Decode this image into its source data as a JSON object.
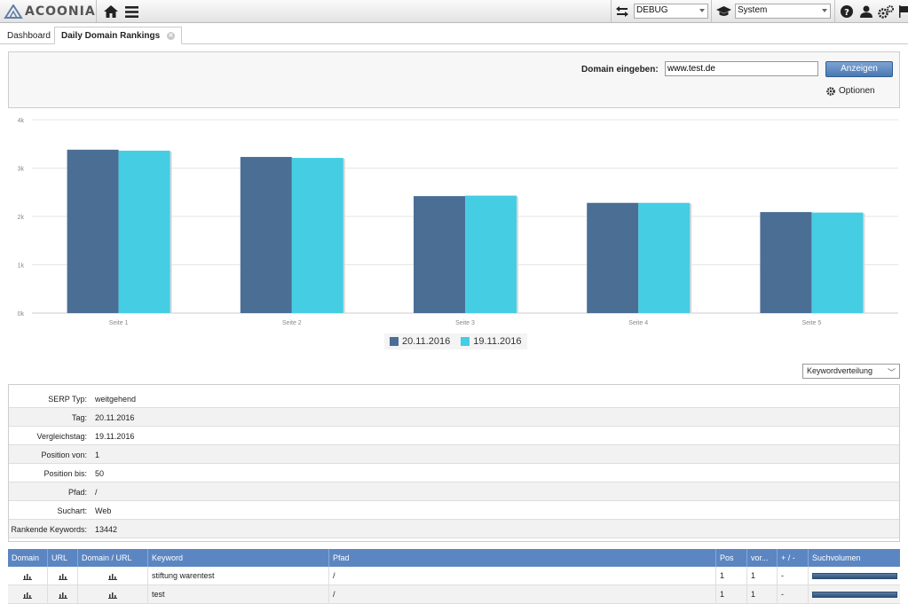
{
  "app": {
    "logo_text": "ACOONIA"
  },
  "toolbar": {
    "debug_select": "DEBUG",
    "system_select": "System",
    "icons": [
      "home-icon",
      "menu-icon",
      "swap-icon",
      "graduation-cap-icon",
      "help-icon",
      "user-icon",
      "cogs-icon",
      "flag-icon"
    ]
  },
  "tabs": [
    {
      "label": "Dashboard",
      "active": false
    },
    {
      "label": "Daily Domain Rankings",
      "active": true
    }
  ],
  "form": {
    "domain_label": "Domain eingeben:",
    "domain_value": "www.test.de",
    "show_button": "Anzeigen",
    "options_label": "Optionen"
  },
  "chart_data": {
    "type": "bar",
    "categories": [
      "Seite 1",
      "Seite 2",
      "Seite 3",
      "Seite 4",
      "Seite 5"
    ],
    "series": [
      {
        "name": "20.11.2016",
        "color": "#4b6e95",
        "values": [
          3380,
          3230,
          2420,
          2280,
          2090
        ]
      },
      {
        "name": "19.11.2016",
        "color": "#45cde4",
        "values": [
          3360,
          3210,
          2430,
          2280,
          2080
        ]
      }
    ],
    "yticks": [
      "0k",
      "1k",
      "2k",
      "3k",
      "4k"
    ],
    "ylim": [
      0,
      4000
    ],
    "grid": true,
    "legend": "bottom-center"
  },
  "keyword_select": "Keywordverteilung",
  "info": [
    {
      "label": "SERP Typ:",
      "value": "weitgehend"
    },
    {
      "label": "Tag:",
      "value": "20.11.2016"
    },
    {
      "label": "Vergleichstag:",
      "value": "19.11.2016"
    },
    {
      "label": "Position von:",
      "value": "1"
    },
    {
      "label": "Position bis:",
      "value": "50"
    },
    {
      "label": "Pfad:",
      "value": "/"
    },
    {
      "label": "Suchart:",
      "value": "Web"
    },
    {
      "label": "Rankende Keywords:",
      "value": "13442"
    }
  ],
  "table": {
    "headers": [
      "Domain",
      "URL",
      "Domain / URL",
      "Keyword",
      "Pfad",
      "Pos",
      "vor...",
      "+ / -",
      "Suchvolumen"
    ],
    "rows": [
      {
        "keyword": "stiftung warentest",
        "pfad": "/",
        "pos": "1",
        "vor": "1",
        "diff": "-"
      },
      {
        "keyword": "test",
        "pfad": "/",
        "pos": "1",
        "vor": "1",
        "diff": "-"
      }
    ]
  }
}
